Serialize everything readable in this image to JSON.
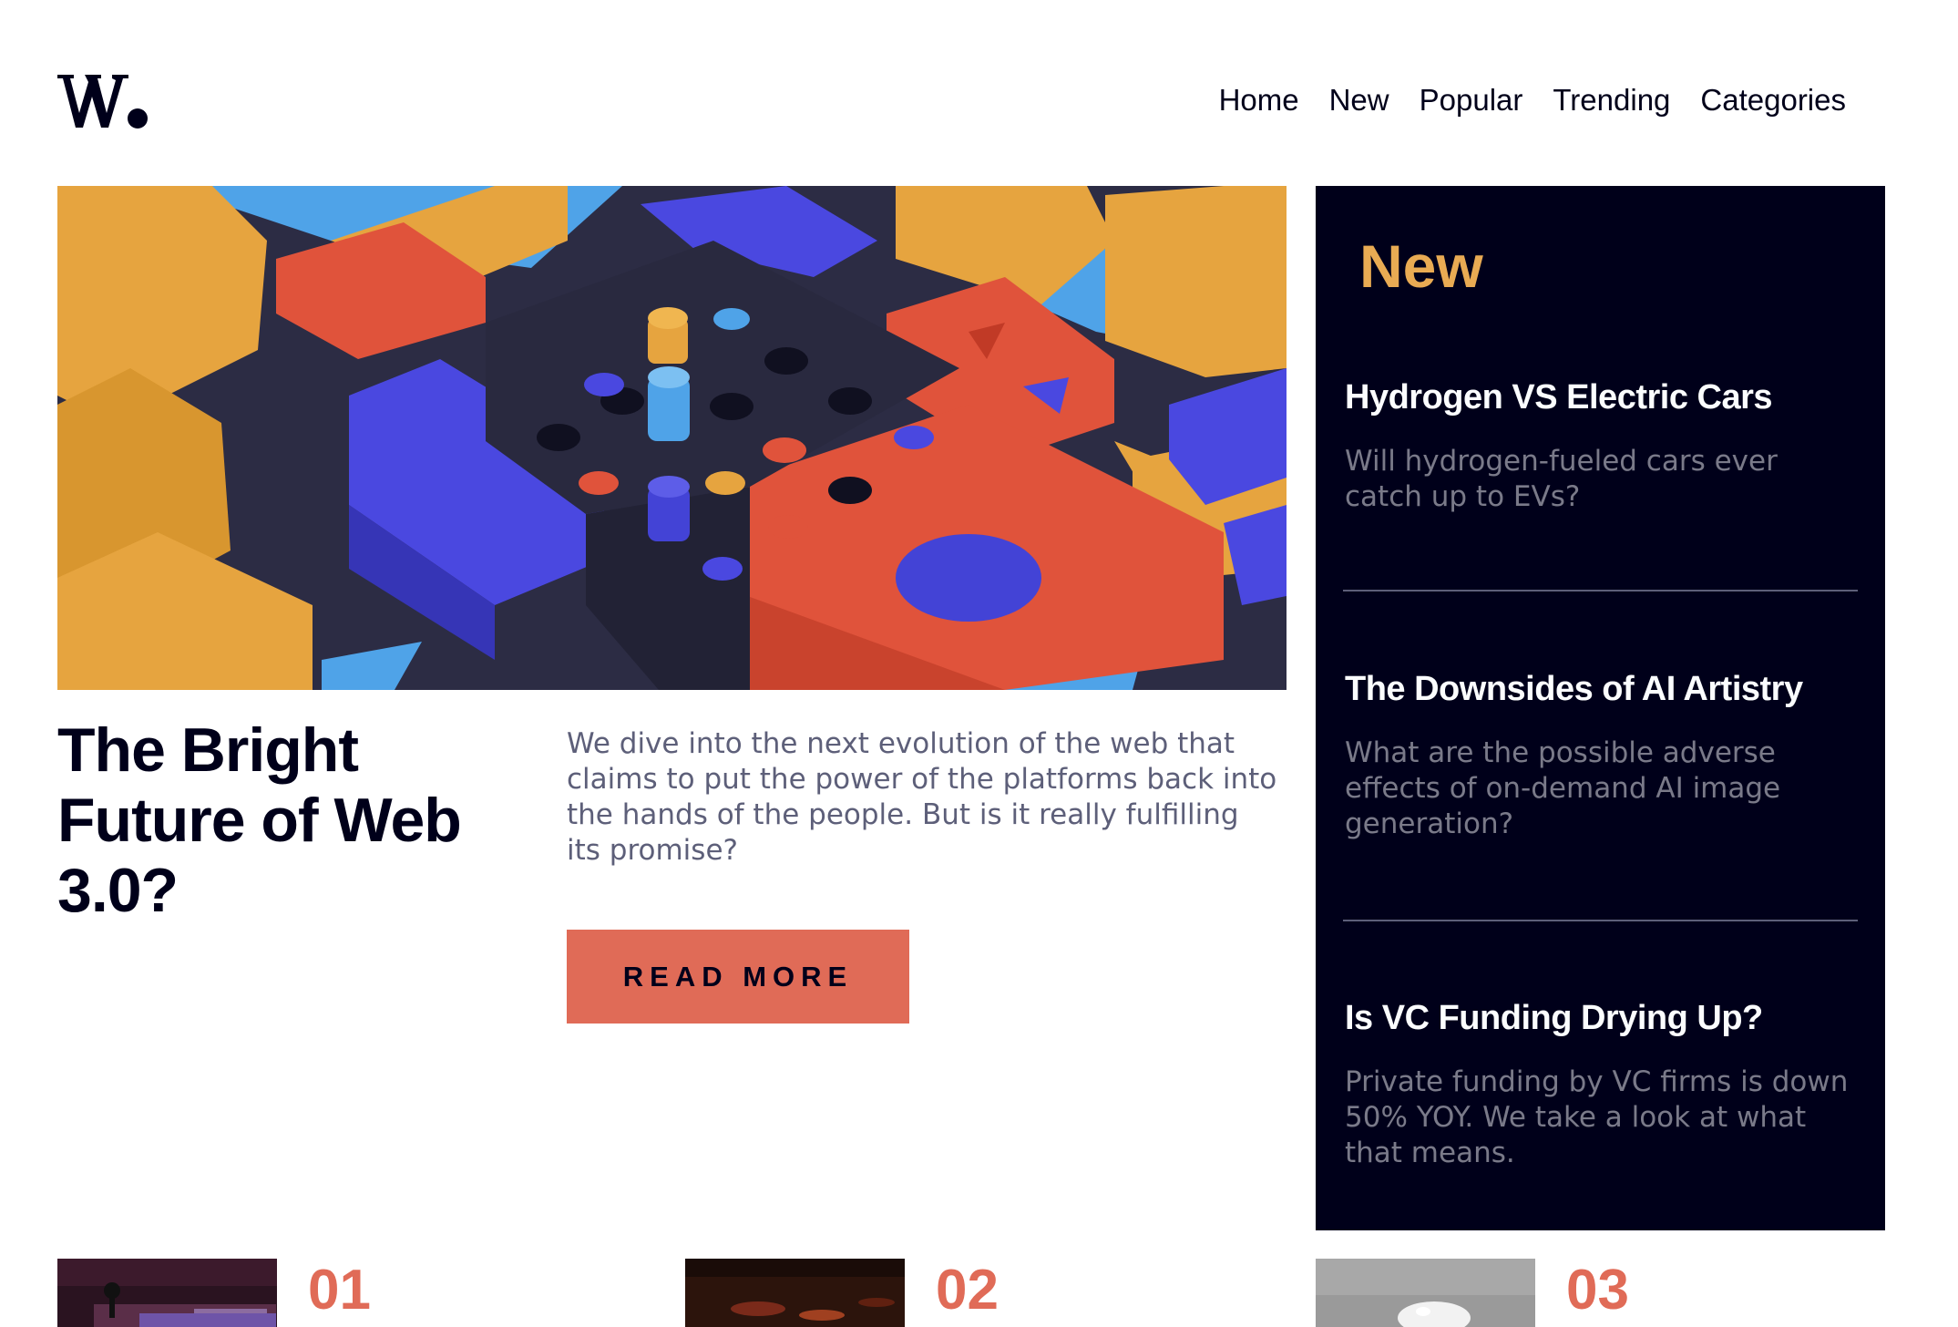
{
  "brand": {
    "logo_text": "W."
  },
  "nav": {
    "items": [
      {
        "label": "Home"
      },
      {
        "label": "New"
      },
      {
        "label": "Popular"
      },
      {
        "label": "Trending"
      },
      {
        "label": "Categories"
      }
    ]
  },
  "hero": {
    "title": "The Bright Future of Web 3.0?",
    "description": "We dive into the next evolution of the web that claims to put the power of the platforms back into the hands of the people. But is it really fulfilling its promise?",
    "cta_label": "READ MORE"
  },
  "new_panel": {
    "heading": "New",
    "items": [
      {
        "title": "Hydrogen VS Electric Cars",
        "summary": "Will hydrogen-fueled cars ever catch up to EVs?"
      },
      {
        "title": "The Downsides of AI Artistry",
        "summary": "What are the possible adverse effects of on-demand AI image generation?"
      },
      {
        "title": "Is VC Funding Drying Up?",
        "summary": "Private funding by VC firms is down 50% YOY. We take a look at what that means."
      }
    ]
  },
  "cards": [
    {
      "number": "01"
    },
    {
      "number": "02"
    },
    {
      "number": "03"
    }
  ],
  "colors": {
    "dark_navy": "#00001a",
    "soft_orange": "#e9ab53",
    "soft_red": "#e06b57",
    "grayish_blue": "#5d5f79",
    "off_white": "#fbfdfe"
  }
}
